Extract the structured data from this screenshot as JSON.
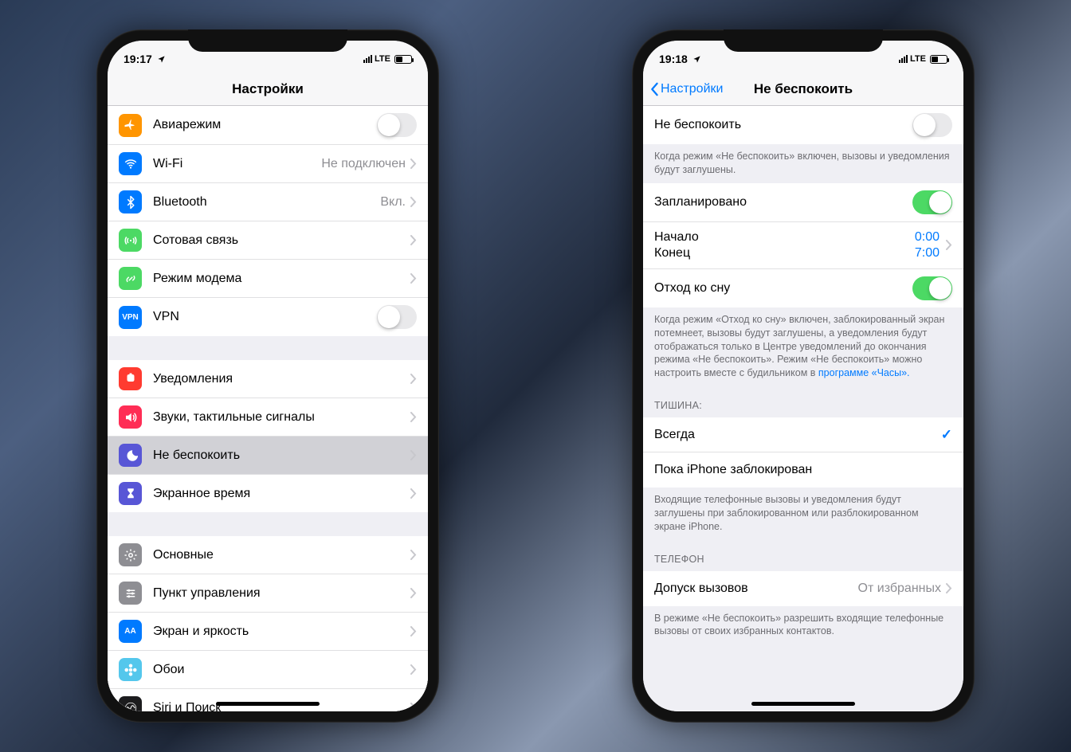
{
  "left": {
    "status": {
      "time": "19:17",
      "net": "LTE"
    },
    "title": "Настройки",
    "g1": [
      {
        "name": "airplane",
        "label": "Авиарежим",
        "type": "toggle",
        "on": false,
        "color": "#ff9500",
        "icon": "plane"
      },
      {
        "name": "wifi",
        "label": "Wi-Fi",
        "type": "link",
        "value": "Не подключен",
        "color": "#007aff",
        "icon": "wifi"
      },
      {
        "name": "bluetooth",
        "label": "Bluetooth",
        "type": "link",
        "value": "Вкл.",
        "color": "#007aff",
        "icon": "bt"
      },
      {
        "name": "cellular",
        "label": "Сотовая связь",
        "type": "link",
        "value": "",
        "color": "#4cd964",
        "icon": "antenna"
      },
      {
        "name": "hotspot",
        "label": "Режим модема",
        "type": "link",
        "value": "",
        "color": "#4cd964",
        "icon": "chain"
      },
      {
        "name": "vpn",
        "label": "VPN",
        "type": "toggle",
        "on": false,
        "color": "#007aff",
        "icon": "text",
        "text": "VPN"
      }
    ],
    "g2": [
      {
        "name": "notifications",
        "label": "Уведомления",
        "color": "#ff3b30",
        "icon": "bell"
      },
      {
        "name": "sounds",
        "label": "Звуки, тактильные сигналы",
        "color": "#ff2d55",
        "icon": "speaker"
      },
      {
        "name": "dnd",
        "label": "Не беспокоить",
        "color": "#5856d6",
        "icon": "moon",
        "tapped": true
      },
      {
        "name": "screentime",
        "label": "Экранное время",
        "color": "#5856d6",
        "icon": "hourglass"
      }
    ],
    "g3": [
      {
        "name": "general",
        "label": "Основные",
        "color": "#8e8e93",
        "icon": "gear"
      },
      {
        "name": "controlcenter",
        "label": "Пункт управления",
        "color": "#8e8e93",
        "icon": "sliders"
      },
      {
        "name": "display",
        "label": "Экран и яркость",
        "color": "#007aff",
        "icon": "text",
        "text": "AA"
      },
      {
        "name": "wallpaper",
        "label": "Обои",
        "color": "#54c7ec",
        "icon": "flower"
      },
      {
        "name": "siri",
        "label": "Siri и Поиск",
        "color": "#1c1c1e",
        "icon": "siri"
      }
    ]
  },
  "right": {
    "status": {
      "time": "19:18",
      "net": "LTE"
    },
    "back": "Настройки",
    "title": "Не беспокоить",
    "dnd_label": "Не беспокоить",
    "dnd_desc": "Когда режим «Не беспокоить» включен, вызовы и уведомления будут заглушены.",
    "scheduled_label": "Запланировано",
    "start_label": "Начало",
    "start_val": "0:00",
    "end_label": "Конец",
    "end_val": "7:00",
    "bedtime_label": "Отход ко сну",
    "bedtime_desc_pre": "Когда режим «Отход ко сну» включен, заблокированный экран потемнеет, вызовы будут заглушены, а уведомления будут отображаться только в Центре уведомлений до окончания режима «Не беспокоить». Режим «Не беспокоить» можно настроить вместе с будильником в ",
    "bedtime_desc_link": "программе «Часы».",
    "silence_header": "ТИШИНА:",
    "silence_always": "Всегда",
    "silence_locked": "Пока iPhone заблокирован",
    "silence_desc": "Входящие телефонные вызовы и уведомления будут заглушены при заблокированном или разблокированном экране iPhone.",
    "phone_header": "ТЕЛЕФОН",
    "allow_label": "Допуск вызовов",
    "allow_value": "От избранных",
    "allow_desc": "В режиме «Не беспокоить» разрешить входящие телефонные вызовы от своих избранных контактов."
  }
}
